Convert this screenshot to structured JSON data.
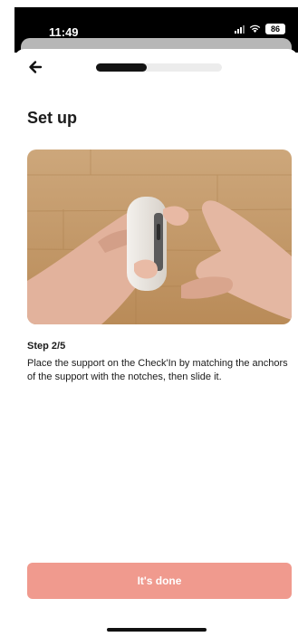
{
  "status_bar": {
    "time": "11:49",
    "battery": "86",
    "icons": [
      "signal-icon",
      "wifi-icon",
      "battery-icon"
    ]
  },
  "header": {
    "back_icon": "arrow-left-icon",
    "progress_fraction": 0.4
  },
  "page": {
    "title": "Set up"
  },
  "illustration": {
    "description_icon": "hands-installing-support-image"
  },
  "step": {
    "label": "Step 2/5",
    "text": "Place the support on the Check'In by matching the anchors of the support with the notches, then slide it."
  },
  "footer": {
    "done_label": "It's done"
  },
  "colors": {
    "accent": "#f09a8e",
    "progress": "#141414",
    "text": "#1b1b1b"
  }
}
